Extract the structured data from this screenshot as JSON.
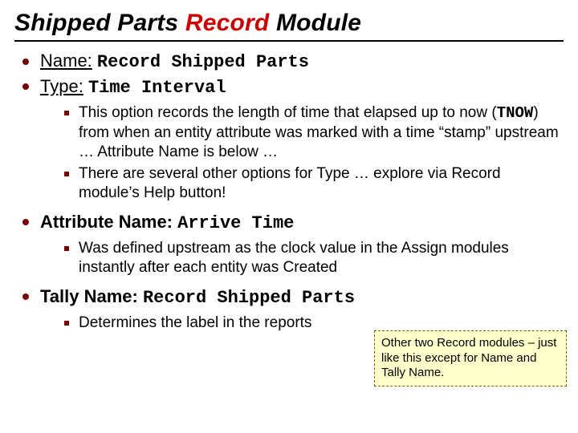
{
  "title": {
    "part1": "Shipped Parts ",
    "part2_red": "Record",
    "part3": " Module"
  },
  "bullets": {
    "name": {
      "label": "Name:",
      "value": "Record Shipped Parts"
    },
    "type": {
      "label": "Type:",
      "value": "Time Interval"
    },
    "type_sub": {
      "a_pre": "This option records the length of time that elapsed up to now (",
      "a_code": "TNOW",
      "a_post": ") from when an entity attribute was marked with a time “stamp” upstream … Attribute Name is below …",
      "b": "There are several other options for Type … explore via Record module’s Help button!"
    },
    "attr": {
      "label": "Attribute Name:",
      "value": "Arrive Time"
    },
    "attr_sub": {
      "a": "Was defined upstream as the clock value in the Assign modules instantly after each entity was Created"
    },
    "tally": {
      "label": "Tally Name:",
      "value": "Record Shipped Parts"
    },
    "tally_sub": {
      "a": "Determines the label in the reports"
    }
  },
  "note": "Other two Record modules – just like this except for Name and Tally Name."
}
